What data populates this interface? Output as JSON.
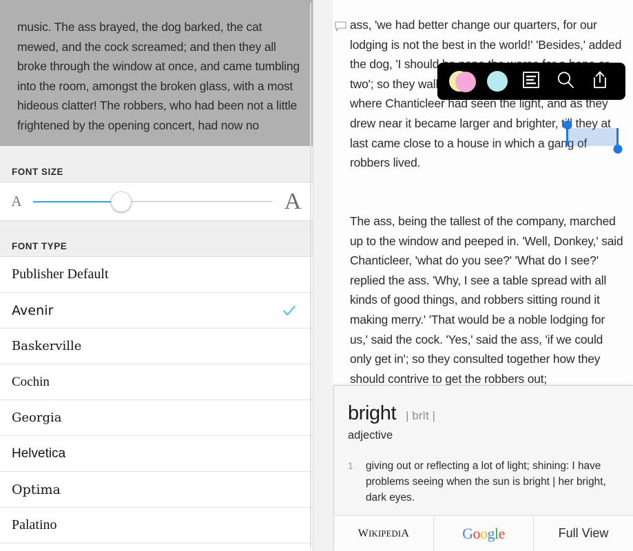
{
  "left_panel": {
    "dimmed_reader_text": "music. The ass brayed, the dog barked, the cat mewed, and the cock screamed; and then they all broke through the window at once, and came tumbling into the room, amongst the broken glass, with a most hideous clatter! The robbers, who had been not a little frightened by the opening concert, had now no",
    "font_size": {
      "header": "FONT SIZE",
      "small_a": "A",
      "large_a": "A",
      "slider_value_percent": 42,
      "track_fill_color": "#2ca7e0"
    },
    "font_type": {
      "header": "FONT TYPE",
      "selected": "Avenir",
      "check_color": "#3ec0e8",
      "items": [
        {
          "label": "Publisher Default",
          "selected": false
        },
        {
          "label": "Avenir",
          "selected": true
        },
        {
          "label": "Baskerville",
          "selected": false
        },
        {
          "label": "Cochin",
          "selected": false
        },
        {
          "label": "Georgia",
          "selected": false
        },
        {
          "label": "Helvetica",
          "selected": false
        },
        {
          "label": "Optima",
          "selected": false
        },
        {
          "label": "Palatino",
          "selected": false
        }
      ]
    }
  },
  "right_panel": {
    "annotation_icon": "note-bubble-icon",
    "paragraph_1": "ass, 'we had better change our quarters, for our lodging is not the best in the world!' 'Besides,' added the dog, 'I should be none the worse for a bone or two'; so they walked off together towards the spot where Chanticleer had seen the light, and as they drew near it became larger and brighter, till they at last came close to a house in which a gang of robbers lived.",
    "paragraph_2": "The ass, being the tallest of the company, marched up to the window and peeped in. 'Well, Donkey,' said Chanticleer, 'what do you see?' 'What do I see?' replied the ass. 'Why, I see a table spread with all kinds of good things, and robbers sitting round it making merry.' 'That would be a noble lodging for us,' said the cock. 'Yes,' said the ass, 'if we could only get in'; so they consulted together how they should contrive to get the robbers out;",
    "selection": {
      "selected_word": "brighter",
      "highlight_color": "#3c82dc",
      "handle_color": "#1f78dd"
    },
    "action_toolbar": {
      "items": [
        {
          "name": "highlight-pink-yellow",
          "kind": "swatch-dual",
          "back_color": "#f4f2a8",
          "front_color": "#f9a8d4"
        },
        {
          "name": "highlight-cyan",
          "kind": "swatch-single",
          "color": "#b5eaf0"
        },
        {
          "name": "note-icon",
          "kind": "icon"
        },
        {
          "name": "search-icon",
          "kind": "icon"
        },
        {
          "name": "share-icon",
          "kind": "icon"
        }
      ],
      "background_color": "#000000"
    }
  },
  "dictionary": {
    "word": "bright",
    "phonetic": "| brīt |",
    "part_of_speech": "adjective",
    "entry_number": "1",
    "definition": "giving out or reflecting a lot of light; shining: I have problems seeing when the sun is bright | her bright, dark eyes.",
    "footer": {
      "wikipedia": "WIKIPEDIA",
      "wikipedia_caps": "W",
      "wikipedia_rest": "IKIPEDI",
      "wikipedia_last": "A",
      "google_letters": [
        "G",
        "o",
        "o",
        "g",
        "l",
        "e"
      ],
      "full_view": "Full View"
    }
  }
}
